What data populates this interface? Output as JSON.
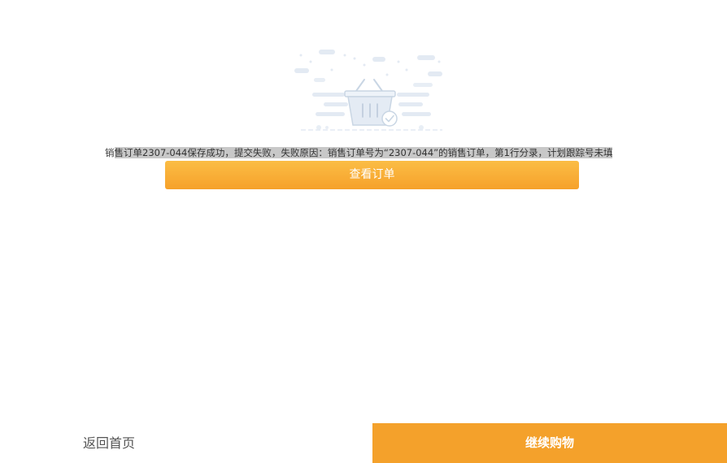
{
  "result": {
    "message_prefix": "销",
    "message_rest": "售订单2307-044保存成功，提交失败，失败原因：销售订单号为“2307-044”的销售订单，第1行分录，计划跟踪号未填",
    "view_order_label": "查看订单",
    "illustration_icon": "empty-basket-check-icon"
  },
  "footer": {
    "home_label": "返回首页",
    "continue_label": "继续购物"
  },
  "colors": {
    "accent": "#f4a12b",
    "button_gradient_top": "#fbbd45",
    "button_gradient_bottom": "#f6a12a",
    "selection_highlight": "#c8c8c8"
  }
}
